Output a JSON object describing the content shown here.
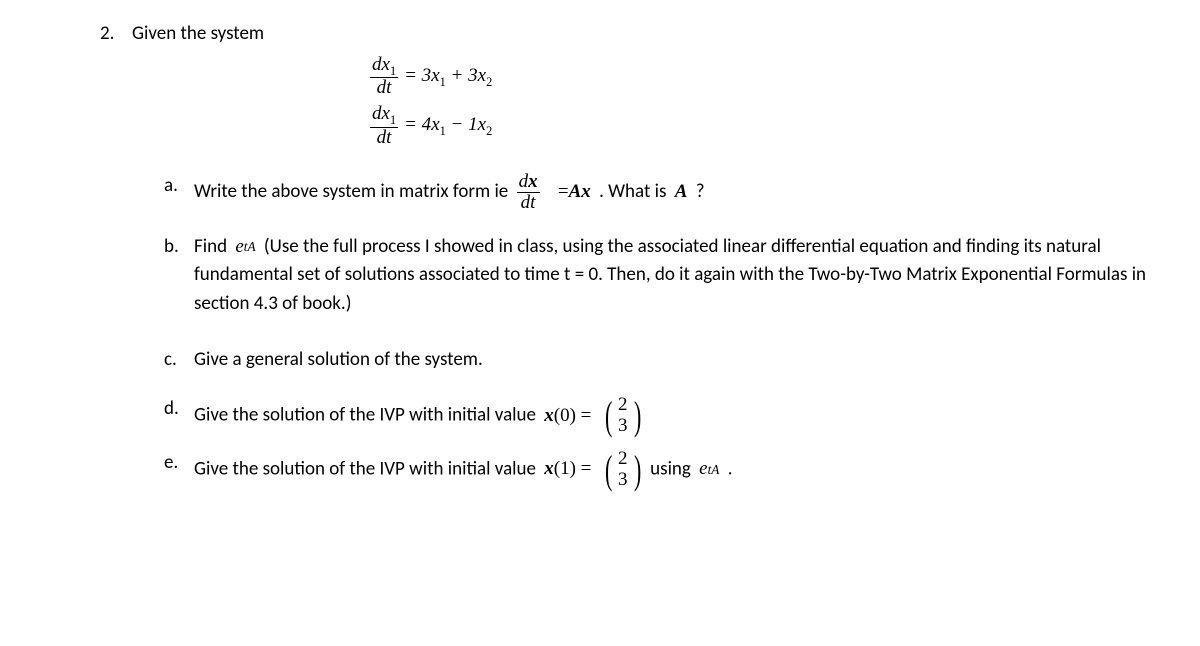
{
  "problem": {
    "number": "2.",
    "intro": "Given the system"
  },
  "equations": {
    "eq1": {
      "lhs_num": "dx",
      "lhs_sub": "1",
      "lhs_den": "dt",
      "rhs_a": "= 3",
      "rhs_x1": "x",
      "rhs_s1": "1",
      "rhs_plus": " + 3",
      "rhs_x2": "x",
      "rhs_s2": "2"
    },
    "eq2": {
      "lhs_num": "dx",
      "lhs_sub": "1",
      "lhs_den": "dt",
      "rhs_a": "= 4",
      "rhs_x1": "x",
      "rhs_s1": "1",
      "rhs_minus": " − 1",
      "rhs_x2": "x",
      "rhs_s2": "2"
    }
  },
  "parts": {
    "a": {
      "label": "a.",
      "text1": "Write the above system in matrix form ie ",
      "frac_num": "d",
      "frac_x": "x",
      "frac_den": "dt",
      "eq": " = ",
      "Ax": "Ax",
      "text2": " . What is ",
      "A": "A",
      "q": " ?"
    },
    "b": {
      "label": "b.",
      "text1": "Find ",
      "e": "e",
      "exp": "tA",
      "text2": " (Use the full process I showed in class, using the associated linear differential equation and finding its natural fundamental set of solutions associated to time t = 0. Then, do it again with the Two-by-Two Matrix Exponential Formulas in section 4.3 of book.)"
    },
    "c": {
      "label": "c.",
      "text": "Give a general solution of the system."
    },
    "d": {
      "label": "d.",
      "text1": "Give the solution of the IVP with initial value ",
      "x": "x",
      "arg": "(0) = ",
      "v1": "2",
      "v2": "3"
    },
    "e": {
      "label": "e.",
      "text1": "Give the solution of the IVP with initial value ",
      "x": "x",
      "arg": "(1) = ",
      "v1": "2",
      "v2": "3",
      "text2": " using ",
      "eexp": "e",
      "exp": "tA",
      "period": " ."
    }
  }
}
